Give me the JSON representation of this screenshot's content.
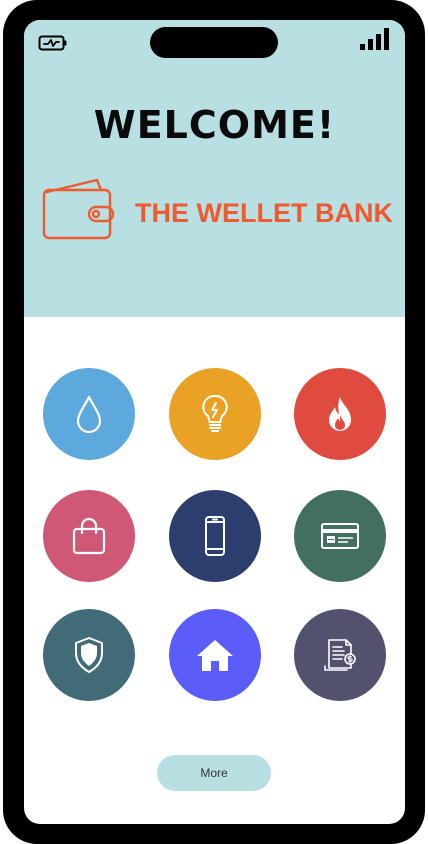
{
  "status_bar": {
    "battery_icon": "battery-charging-icon",
    "signal_icon": "signal-bars-icon"
  },
  "header": {
    "welcome": "WELCOME!",
    "bank_name": "THE WELLET BANK",
    "logo_icon": "wallet-icon",
    "background_color": "#b8dfe2",
    "brand_color": "#f05a2f"
  },
  "services": [
    {
      "icon": "water-drop-icon",
      "color": "#5da9dd"
    },
    {
      "icon": "light-bulb-icon",
      "color": "#e9a226"
    },
    {
      "icon": "fire-icon",
      "color": "#e04b3f"
    },
    {
      "icon": "shopping-bag-icon",
      "color": "#d05877"
    },
    {
      "icon": "mobile-phone-icon",
      "color": "#2b3e6e"
    },
    {
      "icon": "credit-card-icon",
      "color": "#436f61"
    },
    {
      "icon": "shield-icon",
      "color": "#416b77"
    },
    {
      "icon": "home-icon",
      "color": "#5b5dfb"
    },
    {
      "icon": "bill-receipt-icon",
      "color": "#52526f"
    }
  ],
  "more_button": {
    "label": "More",
    "color": "#b8dfe2"
  }
}
